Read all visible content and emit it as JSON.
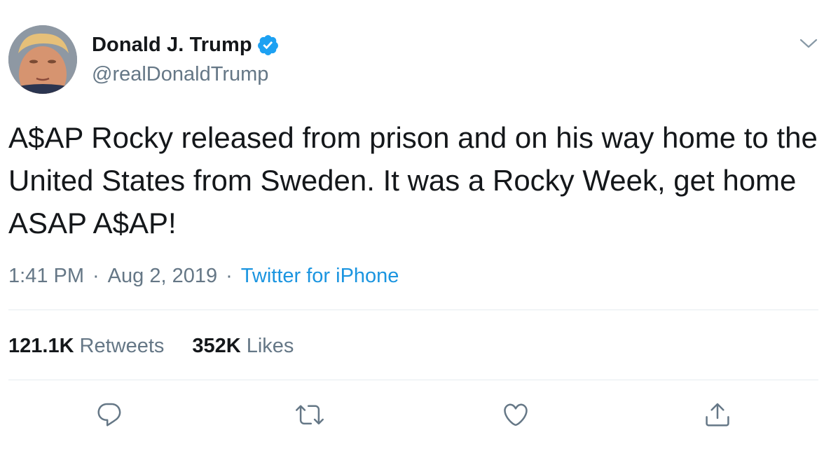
{
  "user": {
    "display_name": "Donald J. Trump",
    "handle": "@realDonaldTrump",
    "verified": true,
    "avatar_icon": "profile-photo"
  },
  "tweet": {
    "text": "A$AP Rocky released from prison and on his way home to the United States from Sweden. It was a Rocky Week, get home ASAP A$AP!"
  },
  "meta": {
    "time": "1:41 PM",
    "separator": "·",
    "date": "Aug 2, 2019",
    "source": "Twitter for iPhone"
  },
  "stats": {
    "retweets_count": "121.1K",
    "retweets_label": "Retweets",
    "likes_count": "352K",
    "likes_label": "Likes"
  },
  "actions": {
    "reply_icon": "reply-icon",
    "retweet_icon": "retweet-icon",
    "like_icon": "heart-icon",
    "share_icon": "share-icon",
    "menu_icon": "chevron-down-icon"
  },
  "colors": {
    "text": "#14171a",
    "muted": "#657786",
    "accent": "#1b95e0",
    "verified": "#1da1f2",
    "divider": "#e6ecf0"
  }
}
